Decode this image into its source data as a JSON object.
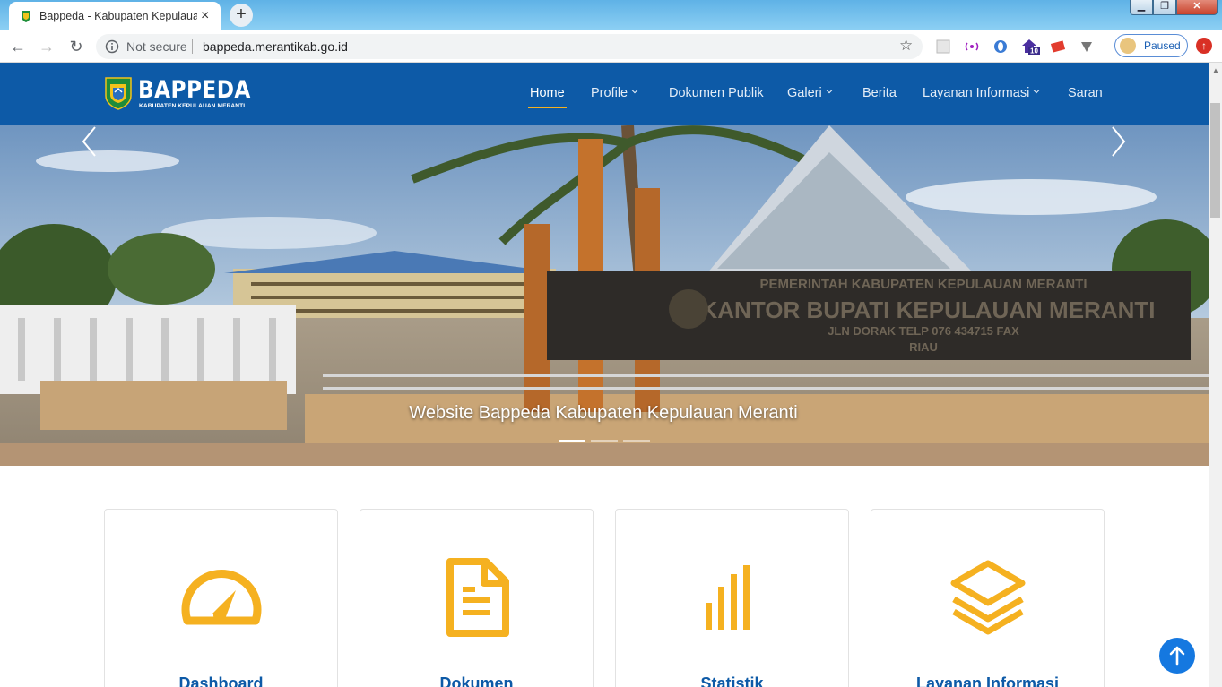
{
  "browser": {
    "tab_title": "Bappeda - Kabupaten Kepulauan Meranti",
    "tab_close": "×",
    "new_tab": "+",
    "security_label": "Not secure",
    "url": "bappeda.merantikab.go.id",
    "profile_status": "Paused",
    "window_controls": {
      "minimize": "▁",
      "maximize": "❐",
      "close": "✕"
    },
    "nav": {
      "back": "←",
      "forward": "→",
      "reload": "↻"
    },
    "bookmark_star": "☆",
    "extension_badge": "10",
    "chrome_menu_badge": "↑"
  },
  "site": {
    "logo_name": "BAPPEDA",
    "logo_subtitle": "KABUPATEN KEPULAUAN MERANTI",
    "nav": [
      {
        "label": "Home",
        "active": true,
        "dropdown": false
      },
      {
        "label": "Profile",
        "active": false,
        "dropdown": true
      },
      {
        "label": "Dokumen Publik",
        "active": false,
        "dropdown": false
      },
      {
        "label": "Galeri",
        "active": false,
        "dropdown": true
      },
      {
        "label": "Berita",
        "active": false,
        "dropdown": false
      },
      {
        "label": "Layanan Informasi",
        "active": false,
        "dropdown": true
      },
      {
        "label": "Saran",
        "active": false,
        "dropdown": false
      }
    ],
    "hero": {
      "caption": "Website Bappeda Kabupaten Kepulauan Meranti",
      "sign_line1": "PEMERINTAH KABUPATEN KEPULAUAN MERANTI",
      "sign_line2": "KANTOR BUPATI KEPULAUAN MERANTI",
      "sign_line3": "JLN DORAK   TELP 076  434715  FAX",
      "sign_line4": "RIAU",
      "slide_count": 3,
      "active_slide": 0
    },
    "cards": [
      {
        "title": "Dashboard",
        "icon": "speedometer-icon"
      },
      {
        "title": "Dokumen",
        "icon": "document-icon"
      },
      {
        "title": "Statistik",
        "icon": "bar-chart-icon"
      },
      {
        "title": "Layanan Informasi",
        "icon": "layers-icon"
      }
    ]
  },
  "colors": {
    "header_blue": "#0d5aa7",
    "accent_yellow": "#f5b120",
    "card_title_blue": "#0d5aa7",
    "to_top_button": "#1578e0"
  }
}
